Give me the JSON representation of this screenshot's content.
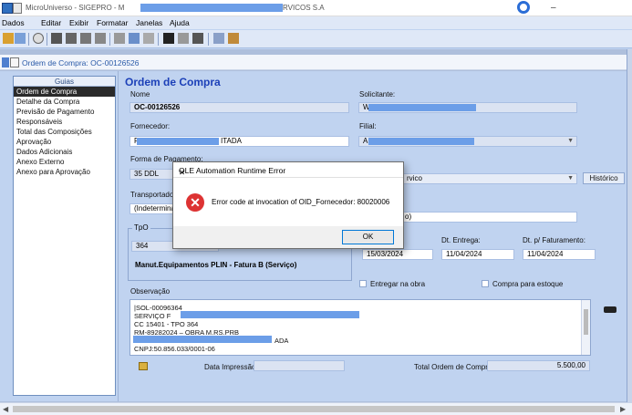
{
  "window": {
    "title_left": "MicroUniverso - SIGEPRO - M",
    "title_right": "RVICOS S.A"
  },
  "menu": [
    "Dados",
    "Editar",
    "Exibir",
    "Formatar",
    "Janelas",
    "Ajuda"
  ],
  "child_window": {
    "title": "Ordem de Compra: OC-00126526"
  },
  "guias": {
    "header": "Guias",
    "items": [
      "Ordem de Compra",
      "Detalhe da Compra",
      "Previsão de Pagamento",
      "Responsáveis",
      "Total das Composições",
      "Aprovação",
      "Dados Adicionais",
      "Anexo Externo",
      "Anexo para Aprovação"
    ],
    "selected_index": 0
  },
  "form": {
    "title": "Ordem de Compra",
    "nome_label": "Nome",
    "nome_value": "OC-00126526",
    "solicitante_label": "Solicitante:",
    "solicitante_value": "W",
    "fornecedor_label": "Fornecedor:",
    "fornecedor_value": "R",
    "fornecedor_value_end": "ITADA",
    "filial_label": "Filial:",
    "filial_value": "A",
    "forma_pagamento_label": "Forma de Pagamento:",
    "forma_pagamento_value": "35 DDL",
    "servico_value": "rvico",
    "historico_button": "Histórico",
    "transportadora_label": "Transportado",
    "transportadora_value": "(Indetermina",
    "campo_value": "o)",
    "tpo_label": "TpO",
    "tpo_code": "364",
    "tpo_desc": "Manut.Equipamentos PLIN - Fatura B (Serviço)",
    "dates": {
      "emissao_value": "15/03/2024",
      "entrega_label": "Dt. Entrega:",
      "entrega_value": "11/04/2024",
      "faturamento_label": "Dt. p/ Faturamento:",
      "faturamento_value": "11/04/2024"
    },
    "entregar_obra_label": "Entregar na obra",
    "compra_estoque_label": "Compra para estoque",
    "observacao_label": "Observação",
    "observacao_lines": [
      "|SOL-00096364",
      "SERVIÇO F",
      "CC 15401 - TPO 364",
      "RM-89282024 – OBRA M.RS.PRB",
      "ADA",
      "CNPJ:50.856.033/0001-06"
    ],
    "data_impressao_label": "Data Impressão:",
    "total_label": "Total Ordem de Compra:",
    "total_value": "5.500,00"
  },
  "dialog": {
    "title": "OLE Automation Runtime Error",
    "close": "✕",
    "icon_glyph": "✕",
    "message": "Error code at invocation of OID_Fornecedor: 80020006",
    "ok_label": "OK"
  },
  "colors": {
    "accent": "#1c40b8",
    "error": "#d33333",
    "redaction": "#6c9ee8"
  }
}
